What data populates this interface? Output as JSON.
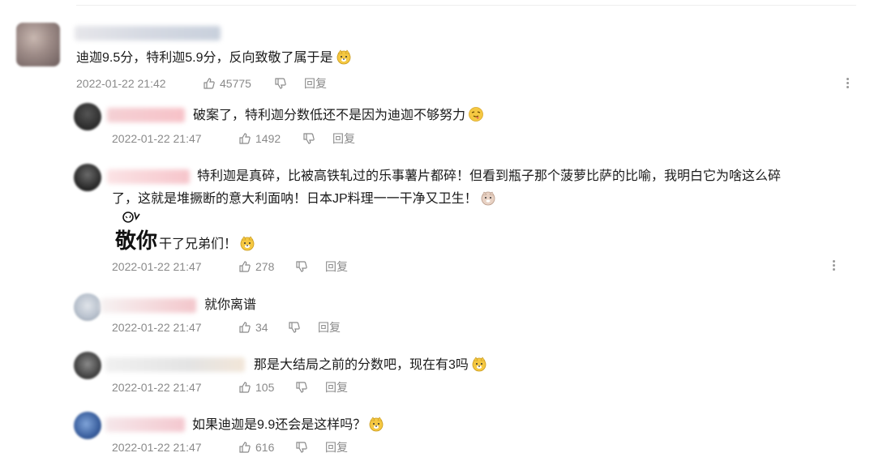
{
  "comments": [
    {
      "text": "迪迦9.5分，特利迦5.9分，反向致敬了属于是",
      "time": "2022-01-22 21:42",
      "likes": "45775",
      "reply_label": "回复"
    }
  ],
  "replies": [
    {
      "text": "破案了，特利迦分数低还不是因为迪迦不够努力",
      "time": "2022-01-22 21:47",
      "likes": "1492",
      "reply_label": "回复"
    },
    {
      "text_line1": "特利迦是真碎，比被高铁轧过的乐事薯片都碎！但看到瓶子那个菠萝比萨的比喻，我明白它为啥这么碎",
      "text_line2": "了，这就是堆撅断的意大利面呐！日本JP料理一一干净又卫生！",
      "text_line3": "干了兄弟们！",
      "sticker_text": "敬你",
      "time": "2022-01-22 21:47",
      "likes": "278",
      "reply_label": "回复"
    },
    {
      "text": "就你离谱",
      "time": "2022-01-22 21:47",
      "likes": "34",
      "reply_label": "回复"
    },
    {
      "text": "那是大结局之前的分数吧，现在有3吗",
      "time": "2022-01-22 21:47",
      "likes": "105",
      "reply_label": "回复"
    },
    {
      "text": "如果迪迦是9.9还会是这样吗？",
      "time": "2022-01-22 21:47",
      "likes": "616",
      "reply_label": "回复"
    }
  ],
  "icons": {
    "like": "thumbs-up-icon",
    "dislike": "thumbs-down-icon",
    "more": "more-vertical-icon",
    "emoji": "doge-emoji-icon"
  },
  "colors": {
    "meta_gray": "#8a8a8a",
    "text": "#1a1a1a",
    "emoji_yellow": "#f5c842"
  }
}
